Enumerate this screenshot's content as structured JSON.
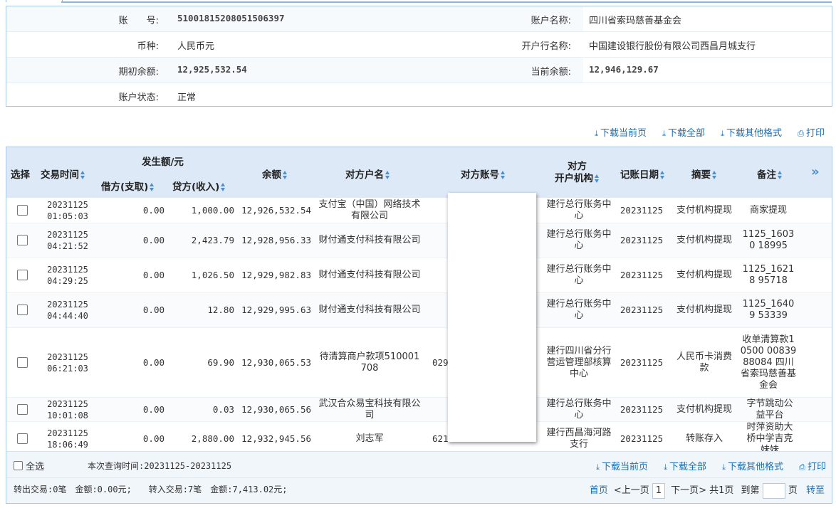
{
  "account": {
    "rows": [
      {
        "l_label": "账　　号:",
        "l_value": "51001815208051506397",
        "r_label": "账户名称:",
        "r_value": "四川省索玛慈善基金会"
      },
      {
        "l_label": "币种:",
        "l_value": "人民币元",
        "r_label": "开户行名称:",
        "r_value": "中国建设银行股份有限公司西昌月城支行"
      },
      {
        "l_label": "期初余额:",
        "l_value": "12,925,532.54",
        "r_label": "当前余额:",
        "r_value": "12,946,129.67"
      },
      {
        "l_label": "账户状态:",
        "l_value": "正常",
        "r_label": "",
        "r_value": ""
      }
    ]
  },
  "download": {
    "current_page": "下载当前页",
    "all": "下载全部",
    "other_format": "下载其他格式",
    "print": "打印"
  },
  "table": {
    "headers": {
      "select": "选择",
      "time": "交易时间",
      "amount_group": "发生额/元",
      "debit": "借方(支取)",
      "credit": "贷方(收入)",
      "balance": "余额",
      "cp_name": "对方户名",
      "cp_account": "对方账号",
      "cp_bank_1": "对方",
      "cp_bank_2": "开户机构",
      "book_date": "记账日期",
      "summary": "摘要",
      "remark": "备注",
      "more": "»"
    },
    "rows": [
      {
        "time1": "20231125",
        "time2": "01:05:03",
        "debit": "0.00",
        "credit": "1,000.00",
        "balance": "12,926,532.54",
        "cp_name": "支付宝（中国）网络技术有限公司",
        "cp_account": "",
        "cp_bank": "建行总行账务中心",
        "book_date": "20231125",
        "summary": "支付机构提现",
        "remark": "商家提现"
      },
      {
        "time1": "20231125",
        "time2": "04:21:52",
        "debit": "0.00",
        "credit": "2,423.79",
        "balance": "12,928,956.33",
        "cp_name": "财付通支付科技有限公司",
        "cp_account": "",
        "cp_bank": "建行总行账务中心",
        "book_date": "20231125",
        "summary": "支付机构提现",
        "remark": "1125_16030 18995"
      },
      {
        "time1": "20231125",
        "time2": "04:29:25",
        "debit": "0.00",
        "credit": "1,026.50",
        "balance": "12,929,982.83",
        "cp_name": "财付通支付科技有限公司",
        "cp_account": "",
        "cp_bank": "建行总行账务中心",
        "book_date": "20231125",
        "summary": "支付机构提现",
        "remark": "1125_16218 95718"
      },
      {
        "time1": "20231125",
        "time2": "04:44:40",
        "debit": "0.00",
        "credit": "12.80",
        "balance": "12,929,995.63",
        "cp_name": "财付通支付科技有限公司",
        "cp_account": "",
        "cp_bank": "建行总行账务中心",
        "book_date": "20231125",
        "summary": "支付机构提现",
        "remark": "1125_16409 53339"
      },
      {
        "time1": "20231125",
        "time2": "06:21:03",
        "debit": "0.00",
        "credit": "69.90",
        "balance": "12,930,065.53",
        "cp_name": "待清算商户款项510001708",
        "cp_account": "029",
        "cp_bank": "建行四川省分行营运管理部核算中心",
        "book_date": "20231125",
        "summary": "人民币卡消费款",
        "remark": "收单清算款10500 00839 88084 四川省索玛慈善基金会"
      },
      {
        "time1": "20231125",
        "time2": "10:01:08",
        "debit": "0.00",
        "credit": "0.03",
        "balance": "12,930,065.56",
        "cp_name": "武汉合众易宝科技有限公司",
        "cp_account": "",
        "cp_bank": "建行总行账务中心",
        "book_date": "20231125",
        "summary": "支付机构提现",
        "remark": "字节跳动公益平台"
      },
      {
        "time1": "20231125",
        "time2": "18:06:49",
        "debit": "0.00",
        "credit": "2,880.00",
        "balance": "12,932,945.56",
        "cp_name": "刘志军",
        "cp_account": "621",
        "cp_bank": "建行西昌海河路支行",
        "book_date": "20231125",
        "summary": "转账存入",
        "remark": "时萍资助大桥中学吉克妹妹"
      }
    ]
  },
  "footer": {
    "select_all": "全选",
    "query_time": "本次查询时间:20231125-20231125",
    "summary_text": "转出交易:0笔　金额:0.00元;　　转入交易:7笔　金额:7,413.02元;",
    "first": "首页",
    "prev": "<上一页",
    "page_num": "1",
    "next": "下一页>",
    "total": "共1页",
    "goto_prefix": "到第",
    "goto_suffix": "页",
    "goto_btn": "转至"
  }
}
